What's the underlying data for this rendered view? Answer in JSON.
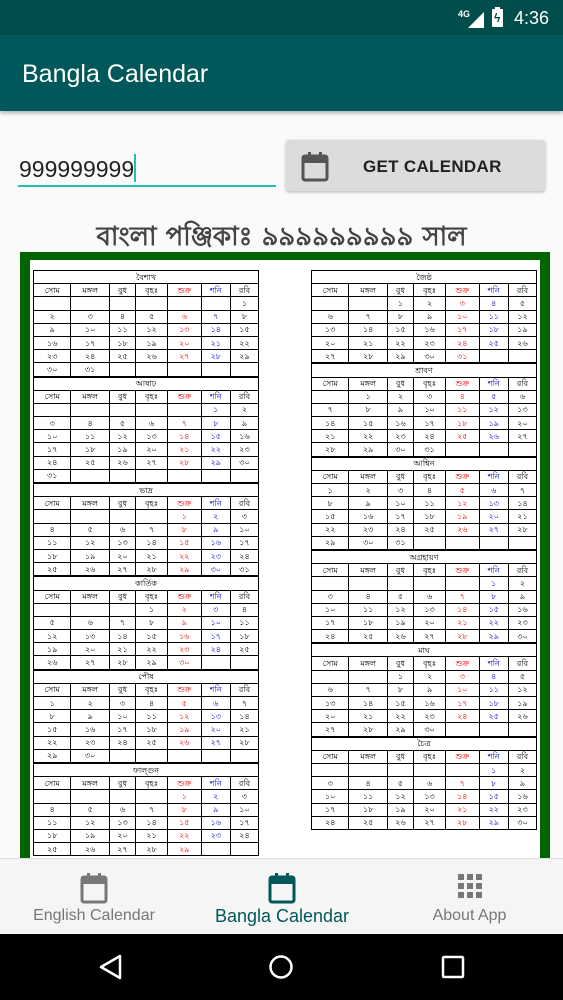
{
  "status": {
    "signal": "4G",
    "time": "4:36"
  },
  "appbar": {
    "title": "Bangla Calendar"
  },
  "year_input": {
    "value": "999999999"
  },
  "get_button": {
    "label": "GET CALENDAR",
    "icon": "calendar-icon"
  },
  "heading": "বাংলা পঞ্জিকাঃ ৯৯৯৯৯৯৯৯৯ সাল",
  "weekdays": [
    "সোম",
    "মঙ্গল",
    "বুধ",
    "বৃহঃ",
    "শুক্র",
    "শনি",
    "রবি"
  ],
  "colors": {
    "appbar": "#00585a",
    "status": "#004d4c",
    "accent": "#1fbfb3",
    "frame": "#006400",
    "friday": "#e00000",
    "saturday": "#0000cc"
  },
  "months": [
    {
      "name": "বৈশাখ",
      "weeks": [
        [
          "",
          "",
          "",
          "",
          "",
          "",
          "১"
        ],
        [
          "২",
          "৩",
          "৪",
          "৫",
          "৬",
          "৭",
          "৮"
        ],
        [
          "৯",
          "১০",
          "১১",
          "১২",
          "১৩",
          "১৪",
          "১৫"
        ],
        [
          "১৬",
          "১৭",
          "১৮",
          "১৯",
          "২০",
          "২১",
          "২২"
        ],
        [
          "২৩",
          "২৪",
          "২৫",
          "২৬",
          "২৭",
          "২৮",
          "২৯"
        ],
        [
          "৩০",
          "৩১",
          "",
          "",
          "",
          "",
          ""
        ]
      ]
    },
    {
      "name": "জৈষ্ঠ",
      "weeks": [
        [
          "",
          "",
          "১",
          "২",
          "৩",
          "৪",
          "৫"
        ],
        [
          "৬",
          "৭",
          "৮",
          "৯",
          "১০",
          "১১",
          "১২"
        ],
        [
          "১৩",
          "১৪",
          "১৫",
          "১৬",
          "১৭",
          "১৮",
          "১৯"
        ],
        [
          "২০",
          "২১",
          "২২",
          "২৩",
          "২৪",
          "২৫",
          "২৬"
        ],
        [
          "২৭",
          "২৮",
          "২৯",
          "৩০",
          "৩১",
          "",
          ""
        ]
      ]
    },
    {
      "name": "আষাঢ়",
      "weeks": [
        [
          "",
          "",
          "",
          "",
          "",
          "১",
          "২"
        ],
        [
          "৩",
          "৪",
          "৫",
          "৬",
          "৭",
          "৮",
          "৯"
        ],
        [
          "১০",
          "১১",
          "১২",
          "১৩",
          "১৪",
          "১৫",
          "১৬"
        ],
        [
          "১৭",
          "১৮",
          "১৯",
          "২০",
          "২১",
          "২২",
          "২৩"
        ],
        [
          "২৪",
          "২৫",
          "২৬",
          "২৭",
          "২৮",
          "২৯",
          "৩০"
        ],
        [
          "৩১",
          "",
          "",
          "",
          "",
          "",
          ""
        ]
      ]
    },
    {
      "name": "শ্রাবণ",
      "weeks": [
        [
          "",
          "১",
          "২",
          "৩",
          "৪",
          "৫",
          "৬"
        ],
        [
          "৭",
          "৮",
          "৯",
          "১০",
          "১১",
          "১২",
          "১৩"
        ],
        [
          "১৪",
          "১৫",
          "১৬",
          "১৭",
          "১৮",
          "১৯",
          "২০"
        ],
        [
          "২১",
          "২২",
          "২৩",
          "২৪",
          "২৫",
          "২৬",
          "২৭"
        ],
        [
          "২৮",
          "২৯",
          "৩০",
          "৩১",
          "",
          "",
          ""
        ]
      ]
    },
    {
      "name": "ভাদ্র",
      "weeks": [
        [
          "",
          "",
          "",
          "",
          "১",
          "২",
          "৩"
        ],
        [
          "৪",
          "৫",
          "৬",
          "৭",
          "৮",
          "৯",
          "১০"
        ],
        [
          "১১",
          "১২",
          "১৩",
          "১৪",
          "১৫",
          "১৬",
          "১৭"
        ],
        [
          "১৮",
          "১৯",
          "২০",
          "২১",
          "২২",
          "২৩",
          "২৪"
        ],
        [
          "২৫",
          "২৬",
          "২৭",
          "২৮",
          "২৯",
          "৩০",
          "৩১"
        ]
      ]
    },
    {
      "name": "আশ্বিন",
      "weeks": [
        [
          "১",
          "২",
          "৩",
          "৪",
          "৫",
          "৬",
          "৭"
        ],
        [
          "৮",
          "৯",
          "১০",
          "১১",
          "১২",
          "১৩",
          "১৪"
        ],
        [
          "১৫",
          "১৬",
          "১৭",
          "১৮",
          "১৯",
          "২০",
          "২১"
        ],
        [
          "২২",
          "২৩",
          "২৪",
          "২৫",
          "২৬",
          "২৭",
          "২৮"
        ],
        [
          "২৯",
          "৩০",
          "৩১",
          "",
          "",
          "",
          ""
        ]
      ]
    },
    {
      "name": "কার্তিক",
      "weeks": [
        [
          "",
          "",
          "",
          "১",
          "২",
          "৩",
          "৪"
        ],
        [
          "৫",
          "৬",
          "৭",
          "৮",
          "৯",
          "১০",
          "১১"
        ],
        [
          "১২",
          "১৩",
          "১৪",
          "১৫",
          "১৬",
          "১৭",
          "১৮"
        ],
        [
          "১৯",
          "২০",
          "২১",
          "২২",
          "২৩",
          "২৪",
          "২৫"
        ],
        [
          "২৬",
          "২৭",
          "২৮",
          "২৯",
          "৩০",
          "",
          ""
        ]
      ]
    },
    {
      "name": "অগ্রহায়ণ",
      "weeks": [
        [
          "",
          "",
          "",
          "",
          "",
          "১",
          "২"
        ],
        [
          "৩",
          "৪",
          "৫",
          "৬",
          "৭",
          "৮",
          "৯"
        ],
        [
          "১০",
          "১১",
          "১২",
          "১৩",
          "১৪",
          "১৫",
          "১৬"
        ],
        [
          "১৭",
          "১৮",
          "১৯",
          "২০",
          "২১",
          "২২",
          "২৩"
        ],
        [
          "২৪",
          "২৫",
          "২৬",
          "২৭",
          "২৮",
          "২৯",
          "৩০"
        ]
      ]
    },
    {
      "name": "পৌষ",
      "weeks": [
        [
          "১",
          "২",
          "৩",
          "৪",
          "৫",
          "৬",
          "৭"
        ],
        [
          "৮",
          "৯",
          "১০",
          "১১",
          "১২",
          "১৩",
          "১৪"
        ],
        [
          "১৫",
          "১৬",
          "১৭",
          "১৮",
          "১৯",
          "২০",
          "২১"
        ],
        [
          "২২",
          "২৩",
          "২৪",
          "২৫",
          "২৬",
          "২৭",
          "২৮"
        ],
        [
          "২৯",
          "৩০",
          "",
          "",
          "",
          "",
          ""
        ]
      ]
    },
    {
      "name": "মাঘ",
      "weeks": [
        [
          "",
          "",
          "১",
          "২",
          "৩",
          "৪",
          "৫"
        ],
        [
          "৬",
          "৭",
          "৮",
          "৯",
          "১০",
          "১১",
          "১২"
        ],
        [
          "১৩",
          "১৪",
          "১৫",
          "১৬",
          "১৭",
          "১৮",
          "১৯"
        ],
        [
          "২০",
          "২১",
          "২২",
          "২৩",
          "২৪",
          "২৫",
          "২৬"
        ],
        [
          "২৭",
          "২৮",
          "২৯",
          "৩০",
          "",
          "",
          ""
        ]
      ]
    },
    {
      "name": "ফাল্গুন",
      "weeks": [
        [
          "",
          "",
          "",
          "",
          "১",
          "২",
          "৩"
        ],
        [
          "৪",
          "৫",
          "৬",
          "৭",
          "৮",
          "৯",
          "১০"
        ],
        [
          "১১",
          "১২",
          "১৩",
          "১৪",
          "১৫",
          "১৬",
          "১৭"
        ],
        [
          "১৮",
          "১৯",
          "২০",
          "২১",
          "২২",
          "২৩",
          "২৪"
        ],
        [
          "২৫",
          "২৬",
          "২৭",
          "২৮",
          "২৯",
          "",
          ""
        ]
      ]
    },
    {
      "name": "চৈত্র",
      "weeks": [
        [
          "",
          "",
          "",
          "",
          "",
          "১",
          "২"
        ],
        [
          "৩",
          "৪",
          "৫",
          "৬",
          "৭",
          "৮",
          "৯"
        ],
        [
          "১০",
          "১১",
          "১২",
          "১৩",
          "১৪",
          "১৫",
          "১৬"
        ],
        [
          "১৭",
          "১৮",
          "১৯",
          "২০",
          "২১",
          "২২",
          "২৩"
        ],
        [
          "২৪",
          "২৫",
          "২৬",
          "২৭",
          "২৮",
          "২৯",
          "৩০"
        ]
      ]
    }
  ],
  "bottom_nav": [
    {
      "label": "English Calendar",
      "icon": "calendar-icon",
      "active": false
    },
    {
      "label": "Bangla Calendar",
      "icon": "calendar-icon",
      "active": true
    },
    {
      "label": "About App",
      "icon": "grid-icon",
      "active": false
    }
  ]
}
